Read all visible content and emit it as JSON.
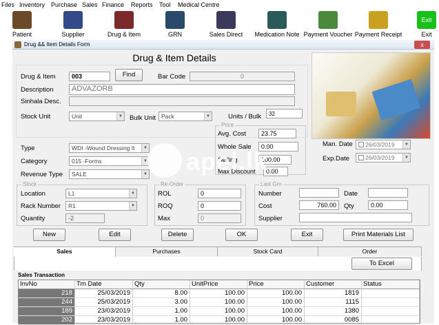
{
  "menu": [
    "Files",
    "Inventory",
    "Purchase",
    "Sales",
    "Finance",
    "Reports",
    "Tool",
    "Medical Centre"
  ],
  "toolbar": [
    {
      "label": "Patient",
      "icon": "patient-icon",
      "color": "#6b4a2a"
    },
    {
      "label": "Supplier",
      "icon": "supplier-icon",
      "color": "#334a8a"
    },
    {
      "label": "Drug & Item",
      "icon": "drug-item-icon",
      "color": "#7a2a2a"
    },
    {
      "label": "GRN",
      "icon": "grn-icon",
      "color": "#2a4a6a"
    },
    {
      "label": "Sales Direct",
      "icon": "sales-direct-icon",
      "color": "#3a3a5a"
    },
    {
      "label": "Medication Note",
      "icon": "medication-note-icon",
      "color": "#2a5a5a"
    },
    {
      "label": "Payment Voucher",
      "icon": "payment-voucher-icon",
      "color": "#4a8a3a"
    },
    {
      "label": "Payment Receipt",
      "icon": "payment-receipt-icon",
      "color": "#c9a020"
    },
    {
      "label": "Exit",
      "icon": "exit-icon",
      "color": "#19c219"
    }
  ],
  "window": {
    "title": "Drug && Item Details Form",
    "close": "x"
  },
  "form": {
    "heading": "Drug & Item Details",
    "drug_item_label": "Drug & Item",
    "drug_item_value": "003",
    "find_button": "Find",
    "barcode_label": "Bar Code",
    "barcode_value": "0",
    "description_label": "Description",
    "description_value": "ADVAZORB",
    "sinhala_label": "Sinhala Desc.",
    "sinhala_value": "",
    "stock_unit_label": "Stock Unit",
    "stock_unit_value": "Unit",
    "bulk_unit_label": "Bulk Unit",
    "bulk_unit_value": "Pack",
    "units_bulk_label": "Units / Bulk",
    "units_bulk_value": "32",
    "price_group": "Price",
    "avg_cost_label": "Avg. Cost",
    "avg_cost_value": "23.75",
    "whole_sale_label": "Whole Sale",
    "whole_sale_value": "0.00",
    "selling_label": "Selling",
    "selling_value": "100.00",
    "max_discount_label": "Max Discount",
    "max_discount_value": "0.00",
    "type_label": "Type",
    "type_value": "WDI -Wound Dressing It",
    "category_label": "Category",
    "category_value": "015 -Forms",
    "revenue_label": "Revenue Type",
    "revenue_value": "SALE",
    "man_date_label": "Man. Date",
    "man_date_value": "26/03/2019",
    "exp_date_label": "Exp.Date",
    "exp_date_value": "26/03/2019",
    "stock_group": "Stock",
    "location_label": "Location",
    "location_value": "L1",
    "rack_label": "Rack Number",
    "rack_value": "R1",
    "quantity_label": "Quantity",
    "quantity_value": "-2",
    "reorder_group": "Re-Order",
    "rol_label": "ROL",
    "rol_value": "0",
    "roq_label": "ROQ",
    "roq_value": "0",
    "max_label": "Max",
    "max_value": "0",
    "lastgrn_group": "Last Grn",
    "number_label": "Number",
    "number_value": "",
    "date_label": "Date",
    "date_value": "",
    "cost_label": "Cost",
    "cost_value": "760.00",
    "qty_label": "Qty",
    "qty_value": "0.00",
    "supplier_label": "Supplier",
    "supplier_value": ""
  },
  "buttons": {
    "new": "New",
    "edit": "Edit",
    "delete": "Delete",
    "ok": "OK",
    "exit": "Exit",
    "print": "Print Materials List"
  },
  "tabs": [
    "Sales",
    "Purchases",
    "Stock Card",
    "Order"
  ],
  "to_excel": "To Excel",
  "sales_group": "Sales Transaction",
  "grid": {
    "columns": [
      "InvNo",
      "Trn Date",
      "Qty",
      "UnitPrice",
      "Price",
      "Customer",
      "Status"
    ],
    "rows": [
      [
        "218",
        "25/03/2019",
        "8.00",
        "100.00",
        "100.00",
        "1819",
        ""
      ],
      [
        "244",
        "25/03/2019",
        "3.00",
        "100.00",
        "100.00",
        "1115",
        ""
      ],
      [
        "189",
        "23/03/2019",
        "1.00",
        "100.00",
        "100.00",
        "1380",
        ""
      ],
      [
        "202",
        "23/03/2019",
        "1.00",
        "100.00",
        "100.00",
        "0085",
        ""
      ]
    ]
  },
  "watermark": "apel.lk"
}
